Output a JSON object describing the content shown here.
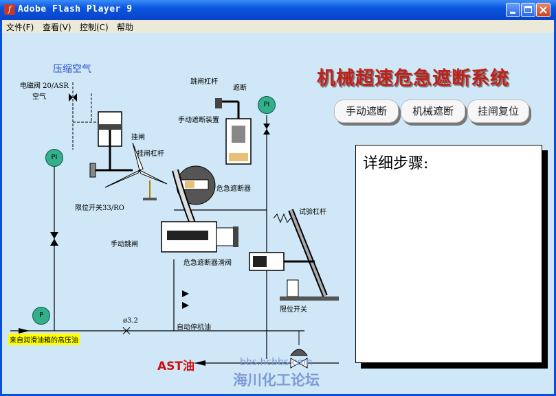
{
  "window": {
    "title": "Adobe Flash Player 9",
    "icon": "flash-icon",
    "controls": [
      "minimize-icon",
      "maximize-icon",
      "close-icon"
    ]
  },
  "menu": {
    "items": [
      {
        "label": "文件(F)"
      },
      {
        "label": "查看(V)"
      },
      {
        "label": "控制(C)"
      },
      {
        "label": "帮助"
      }
    ]
  },
  "main": {
    "title": "机械超速危急遮断系统",
    "buttons": [
      "手动遮断",
      "机械遮断",
      "挂闸复位"
    ],
    "detail_title": "详细步骤:",
    "detail_text": ""
  },
  "diagram": {
    "compressed_air": "压缩空气",
    "solenoid": "电磁阀 20/ASR",
    "air": "空气",
    "latch": "挂闸",
    "latch_lever": "挂闸杠杆",
    "limit_switch": "限位开关33/RO",
    "trip_lever": "跳闸杠杆",
    "trip": "遮断",
    "manual_trip_device": "手动遮断装置",
    "emergency_trip": "危急遮断器",
    "manual_trip_handle": "手动跳闸",
    "trip_valve": "危急遮断器滑阀",
    "test_lever": "试验杠杆",
    "limit_switch2": "限位开关",
    "auto_stop_oil": "自动停机油",
    "orifice": "ø3.2",
    "source_label": "来自润滑油箱的高压油",
    "ast_oil": "AST油",
    "pi": "PI",
    "p": "P"
  },
  "watermark": {
    "url": "bbs.hcbbs.com",
    "name": "海川化工论坛"
  },
  "colors": {
    "background": "#cfe7f6",
    "title_red": "#c0201a",
    "gauge_green": "#33b089",
    "watermark_blue": "#7d9bd8"
  }
}
